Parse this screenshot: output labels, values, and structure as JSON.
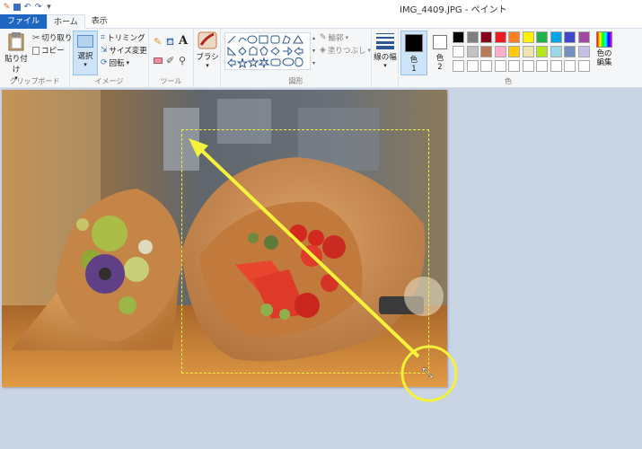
{
  "window": {
    "title": "IMG_4409.JPG - ペイント"
  },
  "tabs": [
    {
      "label": "ファイル"
    },
    {
      "label": "ホーム"
    },
    {
      "label": "表示"
    }
  ],
  "clipboard": {
    "paste_label": "貼り付け",
    "cut_label": "切り取り",
    "copy_label": "コピー",
    "group_label": "クリップボード"
  },
  "image": {
    "select_label": "選択",
    "crop_label": "トリミング",
    "resize_label": "サイズ変更",
    "rotate_label": "回転",
    "group_label": "イメージ"
  },
  "tools": {
    "group_label": "ツール"
  },
  "brushes": {
    "label": "ブラシ"
  },
  "shapes": {
    "outline_label": "輪郭",
    "fill_label": "塗りつぶし",
    "group_label": "図形"
  },
  "size": {
    "label": "線の幅"
  },
  "colors": {
    "color1_label": "色",
    "color1_num": "1",
    "color2_label": "色",
    "color2_num": "2",
    "edit_label": "色の編集",
    "group_label": "色",
    "color1_value": "#000000",
    "color2_value": "#ffffff",
    "palette_row1": [
      "#000000",
      "#7f7f7f",
      "#880015",
      "#ed1c24",
      "#ff7f27",
      "#fff200",
      "#22b14c",
      "#00a2e8",
      "#3f48cc",
      "#a349a4"
    ],
    "palette_row2": [
      "#ffffff",
      "#c3c3c3",
      "#b97a57",
      "#ffaec9",
      "#ffc90e",
      "#efe4b0",
      "#b5e61d",
      "#99d9ea",
      "#7092be",
      "#c8bfe7"
    ]
  },
  "annotation": {
    "arrow_color": "#f4f23a"
  }
}
